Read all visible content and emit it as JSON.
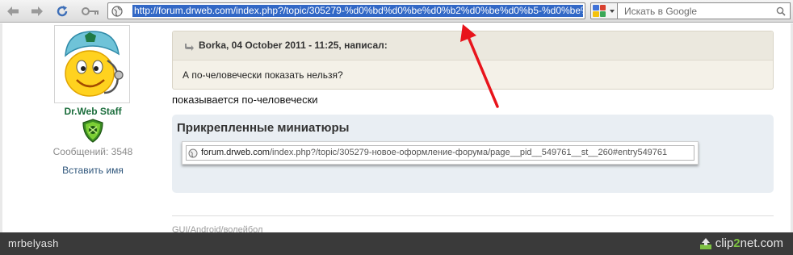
{
  "browser": {
    "address_url": "http://forum.drweb.com/index.php?/topic/305279-%d0%bd%d0%be%d0%b2%d0%be%d0%b5-%d0%be%d18",
    "search_placeholder": "Искать в Google",
    "search_engine": "Google"
  },
  "author": {
    "name": "Dr.Web Staff",
    "post_count_label": "Сообщений: 3548",
    "insert_name_link": "Вставить имя",
    "name_color": "#1c6e3d"
  },
  "quote": {
    "author_line": "Borka, 04 October 2011 - 11:25, написал:",
    "text": "А по-человечески показать нельзя?"
  },
  "post": {
    "text": "показывается по-человечески"
  },
  "attachments": {
    "title": "Прикрепленные миниатюры",
    "thumbnail_url_host": "forum.drweb.com",
    "thumbnail_url_path": "/index.php?/topic/305279-новое-оформление-форума/page__pid__549761__st__260#entry549761"
  },
  "signature": {
    "text": "GUI/Android/волейбол"
  },
  "clip2net": {
    "username": "mrbelyash",
    "brand_prefix": "clip",
    "brand_accent": "2",
    "brand_suffix": "net.com"
  },
  "colors": {
    "url_selection": "#3268c6",
    "annotation_arrow": "#e8141b",
    "clip_accent": "#7dc142"
  }
}
